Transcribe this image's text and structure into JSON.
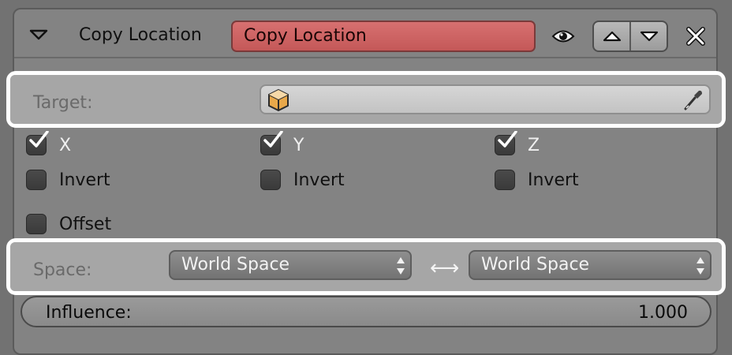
{
  "header": {
    "title": "Copy Location",
    "name_value": "Copy Location",
    "accent_red": "#d06565"
  },
  "target": {
    "label": "Target:",
    "value": ""
  },
  "axes": [
    {
      "label": "X",
      "checked": true
    },
    {
      "label": "Y",
      "checked": true
    },
    {
      "label": "Z",
      "checked": true
    }
  ],
  "inverts": [
    {
      "label": "Invert",
      "checked": false
    },
    {
      "label": "Invert",
      "checked": false
    },
    {
      "label": "Invert",
      "checked": false
    }
  ],
  "offset": {
    "label": "Offset",
    "checked": false
  },
  "space": {
    "label": "Space:",
    "owner": "World Space",
    "target": "World Space",
    "swap_glyph": "⟷"
  },
  "influence": {
    "label": "Influence:",
    "value": "1.000"
  },
  "highlight_color": "#ffffff"
}
